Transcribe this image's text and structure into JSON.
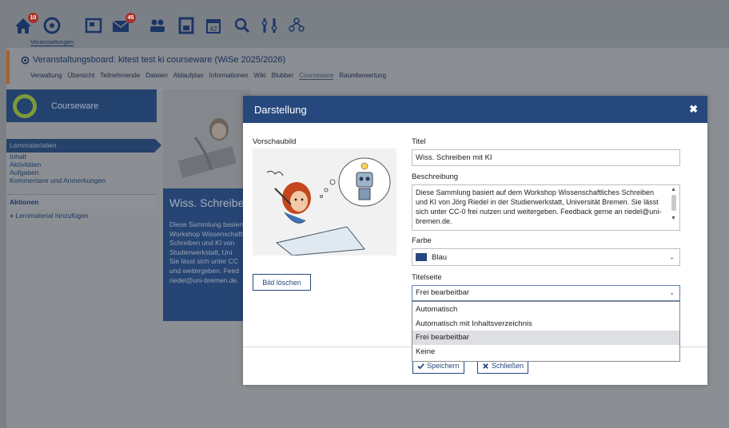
{
  "topnav": {
    "active_label": "Veranstaltungen",
    "badges": {
      "start": "10",
      "messages": "45"
    },
    "icons": [
      "home-icon",
      "courses-icon",
      "news-icon",
      "messages-icon",
      "community-icon",
      "profile-icon",
      "calendar-icon",
      "search-icon",
      "tools-icon",
      "admin-icon"
    ]
  },
  "context": {
    "title": "Veranstaltungsboard: kitest test ki courseware (WiSe 2025/2026)",
    "tabs": [
      "Verwaltung",
      "Übersicht",
      "Teilnehmende",
      "Dateien",
      "Ablaufplan",
      "Informationen",
      "Wiki",
      "Blubber",
      "Courseware",
      "Raumbewertung"
    ],
    "active_tab": "Courseware"
  },
  "sidebar": {
    "header": "Courseware",
    "items": [
      "Lernmaterialien",
      "Inhalt",
      "Aktivitäten",
      "Aufgaben",
      "Kommentare und Anmerkungen"
    ],
    "actions_title": "Aktionen",
    "add_label": "Lernmaterial hinzufügen"
  },
  "card": {
    "title": "Wiss. Schreiben mit KI",
    "desc_lines": [
      "Diese Sammlung basiert",
      "Workshop Wissenschaftl",
      "Schreiben und KI von",
      "Studierwerkstatt, Uni",
      "Sie lässt sich unter CC",
      "und weitergeben. Feed",
      "riedel@uni-bremen.de."
    ]
  },
  "modal": {
    "title": "Darstellung",
    "close_symbol": "✖",
    "preview_label": "Vorschaubild",
    "delete_image": "Bild löschen",
    "title_label": "Titel",
    "title_value": "Wiss. Schreiben mit KI",
    "desc_label": "Beschreibung",
    "desc_value": "Diese Sammlung basiert auf dem Workshop Wissenschaftliches Schreiben und KI von Jörg Riedel in der Studierwerkstatt, Universität Bremen. Sie lässt sich unter CC-0 frei nutzen und weitergeben. Feedback gerne an riedel@uni-bremen.de.",
    "color_label": "Farbe",
    "color_value": "Blau",
    "color_hex": "#27487d",
    "titlepage_label": "Titelseite",
    "titlepage_value": "Frei bearbeitbar",
    "titlepage_options": [
      "Automatisch",
      "Automatisch mit Inhaltsverzeichnis",
      "Frei bearbeitbar",
      "Keine"
    ],
    "save": "Speichern",
    "close": "Schließen"
  }
}
